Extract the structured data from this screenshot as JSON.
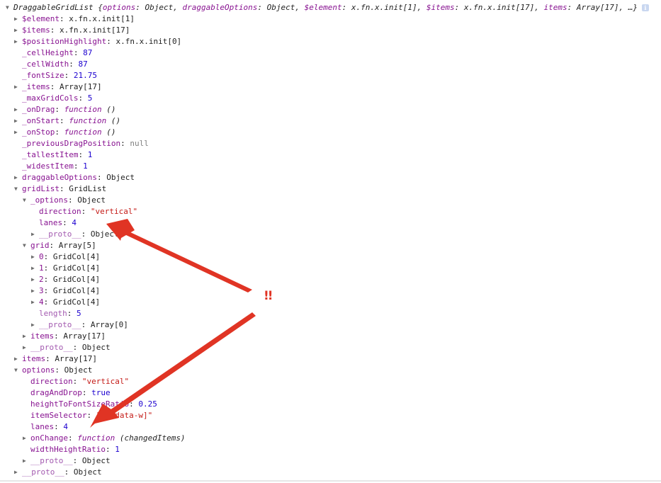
{
  "colors": {
    "own_key": "#881391",
    "inherited_key": "#a35ab0",
    "number": "#1c00cf",
    "string": "#c41a16",
    "null": "#808080",
    "arrow": "#e03424"
  },
  "summary": {
    "prefix": "DraggableGridList {",
    "parts": [
      {
        "k": "options",
        "v": "Object"
      },
      {
        "k": "draggableOptions",
        "v": "Object"
      },
      {
        "k": "$element",
        "v": "x.fn.x.init[1]"
      },
      {
        "k": "$items",
        "v": "x.fn.x.init[17]"
      },
      {
        "k": "items",
        "v": "Array[17]"
      }
    ],
    "suffix": "…}",
    "info_icon": "info-icon"
  },
  "rows": [
    {
      "d": 1,
      "t": "c",
      "k": "$element",
      "c": "own",
      "v": "x.fn.x.init[1]",
      "vc": "obj"
    },
    {
      "d": 1,
      "t": "c",
      "k": "$items",
      "c": "own",
      "v": "x.fn.x.init[17]",
      "vc": "obj"
    },
    {
      "d": 1,
      "t": "c",
      "k": "$positionHighlight",
      "c": "own",
      "v": "x.fn.x.init[0]",
      "vc": "obj"
    },
    {
      "d": 1,
      "t": "n",
      "k": "_cellHeight",
      "c": "own",
      "v": "87",
      "vc": "num"
    },
    {
      "d": 1,
      "t": "n",
      "k": "_cellWidth",
      "c": "own",
      "v": "87",
      "vc": "num"
    },
    {
      "d": 1,
      "t": "n",
      "k": "_fontSize",
      "c": "own",
      "v": "21.75",
      "vc": "num"
    },
    {
      "d": 1,
      "t": "c",
      "k": "_items",
      "c": "own",
      "v": "Array[17]",
      "vc": "obj"
    },
    {
      "d": 1,
      "t": "n",
      "k": "_maxGridCols",
      "c": "own",
      "v": "5",
      "vc": "num"
    },
    {
      "d": 1,
      "t": "c",
      "k": "_onDrag",
      "c": "own",
      "fn": "function",
      "v": "()",
      "vc": "fnsig"
    },
    {
      "d": 1,
      "t": "c",
      "k": "_onStart",
      "c": "own",
      "fn": "function",
      "v": "()",
      "vc": "fnsig"
    },
    {
      "d": 1,
      "t": "c",
      "k": "_onStop",
      "c": "own",
      "fn": "function",
      "v": "()",
      "vc": "fnsig"
    },
    {
      "d": 1,
      "t": "n",
      "k": "_previousDragPosition",
      "c": "own",
      "v": "null",
      "vc": "null"
    },
    {
      "d": 1,
      "t": "n",
      "k": "_tallestItem",
      "c": "own",
      "v": "1",
      "vc": "num"
    },
    {
      "d": 1,
      "t": "n",
      "k": "_widestItem",
      "c": "own",
      "v": "1",
      "vc": "num"
    },
    {
      "d": 1,
      "t": "c",
      "k": "draggableOptions",
      "c": "own",
      "v": "Object",
      "vc": "obj"
    },
    {
      "d": 1,
      "t": "o",
      "k": "gridList",
      "c": "own",
      "v": "GridList",
      "vc": "obj"
    },
    {
      "d": 2,
      "t": "o",
      "k": "_options",
      "c": "own",
      "v": "Object",
      "vc": "obj"
    },
    {
      "d": 3,
      "t": "n",
      "k": "direction",
      "c": "own",
      "v": "\"vertical\"",
      "vc": "str"
    },
    {
      "d": 3,
      "t": "n",
      "k": "lanes",
      "c": "own",
      "v": "4",
      "vc": "num"
    },
    {
      "d": 3,
      "t": "c",
      "k": "__proto__",
      "c": "inh",
      "v": "Object",
      "vc": "obj"
    },
    {
      "d": 2,
      "t": "o",
      "k": "grid",
      "c": "own",
      "v": "Array[5]",
      "vc": "obj"
    },
    {
      "d": 3,
      "t": "c",
      "k": "0",
      "c": "own",
      "v": "GridCol[4]",
      "vc": "obj"
    },
    {
      "d": 3,
      "t": "c",
      "k": "1",
      "c": "own",
      "v": "GridCol[4]",
      "vc": "obj"
    },
    {
      "d": 3,
      "t": "c",
      "k": "2",
      "c": "own",
      "v": "GridCol[4]",
      "vc": "obj"
    },
    {
      "d": 3,
      "t": "c",
      "k": "3",
      "c": "own",
      "v": "GridCol[4]",
      "vc": "obj"
    },
    {
      "d": 3,
      "t": "c",
      "k": "4",
      "c": "own",
      "v": "GridCol[4]",
      "vc": "obj"
    },
    {
      "d": 3,
      "t": "n",
      "k": "length",
      "c": "inh",
      "v": "5",
      "vc": "num"
    },
    {
      "d": 3,
      "t": "c",
      "k": "__proto__",
      "c": "inh",
      "v": "Array[0]",
      "vc": "obj"
    },
    {
      "d": 2,
      "t": "c",
      "k": "items",
      "c": "own",
      "v": "Array[17]",
      "vc": "obj"
    },
    {
      "d": 2,
      "t": "c",
      "k": "__proto__",
      "c": "inh",
      "v": "Object",
      "vc": "obj"
    },
    {
      "d": 1,
      "t": "c",
      "k": "items",
      "c": "own",
      "v": "Array[17]",
      "vc": "obj"
    },
    {
      "d": 1,
      "t": "o",
      "k": "options",
      "c": "own",
      "v": "Object",
      "vc": "obj"
    },
    {
      "d": 2,
      "t": "n",
      "k": "direction",
      "c": "own",
      "v": "\"vertical\"",
      "vc": "str"
    },
    {
      "d": 2,
      "t": "n",
      "k": "dragAndDrop",
      "c": "own",
      "v": "true",
      "vc": "bool"
    },
    {
      "d": 2,
      "t": "n",
      "k": "heightToFontSizeRatio",
      "c": "own",
      "v": "0.25",
      "vc": "num"
    },
    {
      "d": 2,
      "t": "n",
      "k": "itemSelector",
      "c": "own",
      "v": "\"li[data-w]\"",
      "vc": "str"
    },
    {
      "d": 2,
      "t": "n",
      "k": "lanes",
      "c": "own",
      "v": "4",
      "vc": "num"
    },
    {
      "d": 2,
      "t": "c",
      "k": "onChange",
      "c": "own",
      "fn": "function",
      "v": "(changedItems)",
      "vc": "fnsig"
    },
    {
      "d": 2,
      "t": "n",
      "k": "widthHeightRatio",
      "c": "own",
      "v": "1",
      "vc": "num"
    },
    {
      "d": 2,
      "t": "c",
      "k": "__proto__",
      "c": "inh",
      "v": "Object",
      "vc": "obj"
    },
    {
      "d": 1,
      "t": "c",
      "k": "__proto__",
      "c": "inh",
      "v": "Object",
      "vc": "obj"
    }
  ],
  "annotation": {
    "marker": "!!",
    "arrows": [
      "arrow-to-options-lanes",
      "arrow-to-options-lanes-bottom"
    ]
  }
}
